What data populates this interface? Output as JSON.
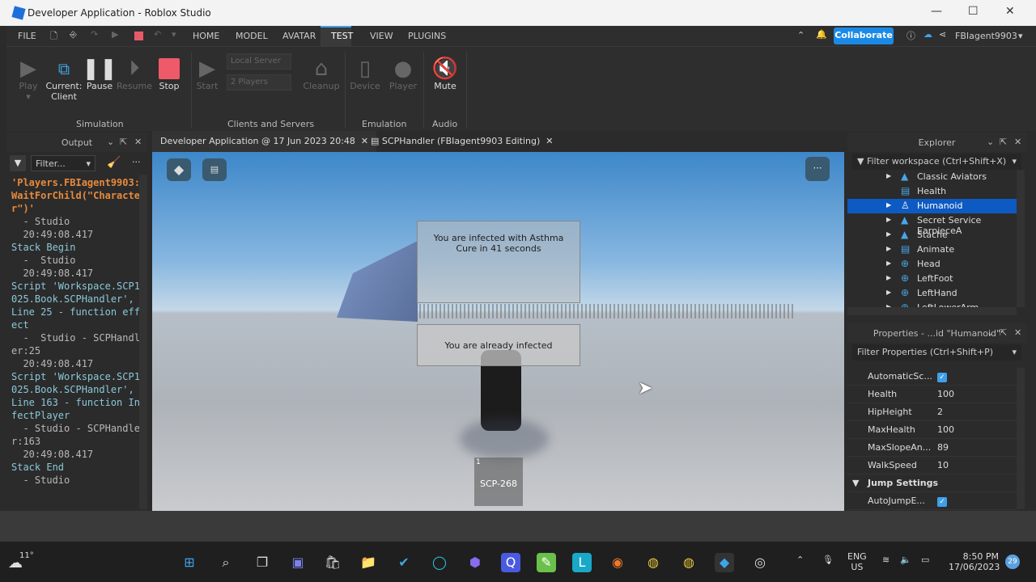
{
  "window": {
    "title": "Developer Application - Roblox Studio"
  },
  "menu": {
    "items": [
      "FILE",
      "HOME",
      "MODEL",
      "AVATAR",
      "TEST",
      "VIEW",
      "PLUGINS"
    ],
    "active": "TEST",
    "collaborate": "Collaborate",
    "user": "FBIagent9903"
  },
  "ribbon": {
    "play": "Play",
    "current": "Current:",
    "client": "Client",
    "pause": "Pause",
    "resume": "Resume",
    "stop": "Stop",
    "start": "Start",
    "server_select": "Local Server",
    "players_select": "2 Players",
    "cleanup": "Cleanup",
    "device": "Device",
    "player": "Player",
    "mute": "Mute",
    "groups": [
      "Simulation",
      "Clients and Servers",
      "Emulation",
      "Audio"
    ]
  },
  "output": {
    "title": "Output",
    "filter_placeholder": "Filter...",
    "lines": [
      {
        "text": "'Players.FBIagent9903:WaitForChild(\"Character\")'",
        "style": "o"
      },
      {
        "text": "  - Studio",
        "style": "g"
      },
      {
        "text": "  20:49:08.417",
        "style": "g"
      },
      {
        "text": "Stack Begin",
        "style": "c"
      },
      {
        "text": "  -  Studio",
        "style": "g"
      },
      {
        "text": "  20:49:08.417",
        "style": "g"
      },
      {
        "text": "Script 'Workspace.SCP1025.Book.SCPHandler', Line 25 - function effect",
        "style": "c"
      },
      {
        "text": "  -  Studio - SCPHandler:25",
        "style": "g"
      },
      {
        "text": "  20:49:08.417",
        "style": "g"
      },
      {
        "text": "Script 'Workspace.SCP1025.Book.SCPHandler', Line 163 - function InfectPlayer",
        "style": "c"
      },
      {
        "text": "  - Studio - SCPHandler:163",
        "style": "g"
      },
      {
        "text": "  20:49:08.417",
        "style": "g"
      },
      {
        "text": "Stack End",
        "style": "c"
      },
      {
        "text": "  - Studio",
        "style": "g"
      }
    ]
  },
  "tabs": [
    {
      "label": "Developer Application @ 17 Jun 2023 20:48"
    },
    {
      "label": "SCPHandler (FBIagent9903 Editing)"
    }
  ],
  "game": {
    "infected_msg": "You are infected with Asthma",
    "cure_msg": "Cure in 41 seconds",
    "already_msg": "You are already infected",
    "item_count": "1",
    "item_name": "SCP-268"
  },
  "explorer": {
    "title": "Explorer",
    "filter": "Filter workspace (Ctrl+Shift+X)",
    "items": [
      {
        "label": "Classic Aviators",
        "icon": "accessory-icon"
      },
      {
        "label": "Health",
        "icon": "script-icon"
      },
      {
        "label": "Humanoid",
        "icon": "humanoid-icon",
        "selected": true
      },
      {
        "label": "Secret Service EarpieceA",
        "icon": "accessory-icon"
      },
      {
        "label": "Stache",
        "icon": "accessory-icon"
      },
      {
        "label": "Animate",
        "icon": "localscript-icon"
      },
      {
        "label": "Head",
        "icon": "meshpart-icon"
      },
      {
        "label": "LeftFoot",
        "icon": "meshpart-icon"
      },
      {
        "label": "LeftHand",
        "icon": "meshpart-icon"
      },
      {
        "label": "LeftLowerArm",
        "icon": "meshpart-icon"
      }
    ]
  },
  "properties": {
    "title": "Properties - ...id \"Humanoid\"",
    "filter": "Filter Properties (Ctrl+Shift+P)",
    "rows": [
      {
        "k": "AutomaticSc...",
        "checked": true
      },
      {
        "k": "Health",
        "v": "100"
      },
      {
        "k": "HipHeight",
        "v": "2"
      },
      {
        "k": "MaxHealth",
        "v": "100"
      },
      {
        "k": "MaxSlopeAn...",
        "v": "89"
      },
      {
        "k": "WalkSpeed",
        "v": "10"
      }
    ],
    "section": "Jump Settings",
    "after": [
      {
        "k": "AutoJumpE...",
        "checked": true
      }
    ]
  },
  "taskbar": {
    "weather": "11°",
    "lang1": "ENG",
    "lang2": "US",
    "time": "8:50 PM",
    "date": "17/06/2023",
    "badge": "29"
  }
}
